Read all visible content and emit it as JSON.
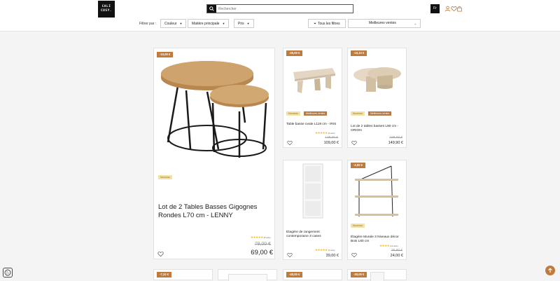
{
  "header": {
    "logo_text": [
      "CALI",
      "COSY."
    ],
    "search_placeholder": "Rechercher",
    "language": "Fr",
    "icons": [
      "search-icon",
      "user-icon",
      "heart-icon",
      "bag-icon"
    ]
  },
  "filters": {
    "label": "Filtrer par :",
    "buttons": [
      "Couleur",
      "Matière principale",
      "Prix"
    ],
    "all_filters": "Tous les filtres",
    "sort": "Meilleures ventes"
  },
  "colors": {
    "accent": "#c07a3c",
    "tag_yellow": "#f1e3a6",
    "stars": "#f1b92e"
  },
  "products": [
    {
      "badge": "-10,00 €",
      "tags": [
        "Nouveau"
      ],
      "title": "Lot de 2 Tables Basses Gigognes Rondes L70 cm - LENNY",
      "stars": "★★★★★",
      "reviews": "(8 avis)",
      "old_price": "79,00 €",
      "price": "69,00 €"
    },
    {
      "badge": "-30,00 €",
      "tags": [
        "Nouveau",
        "Meilleures ventes"
      ],
      "title": "Table basse ovale L119 cm - IRIS",
      "stars": "★★★★★",
      "reviews": "(6 avis)",
      "old_price": "139,00 €",
      "price": "109,00 €"
    },
    {
      "badge": "-19,10 €",
      "tags": [
        "Nouveau",
        "Meilleures ventes"
      ],
      "title": "Lot de 2 tables basses L90 cm - ORION",
      "old_price": "169,00 €",
      "price": "149,90 €"
    },
    {
      "title": "Etagère de rangement contemporaine 3 cases",
      "stars": "★★★★★",
      "reviews": "(3 avis)",
      "price": "39,00 €"
    },
    {
      "badge": "-2,90 €",
      "tags": [
        "Nouveau"
      ],
      "title": "Étagère Murale 3 Niveaux décor Bois L60 cm",
      "stars": "★★★★",
      "reviews": "(12 avis)",
      "old_price": "26,90 €",
      "price": "24,00 €"
    }
  ],
  "bottom_badges": [
    "-7,10 €",
    "-40,00 €",
    "-30,00 €"
  ]
}
